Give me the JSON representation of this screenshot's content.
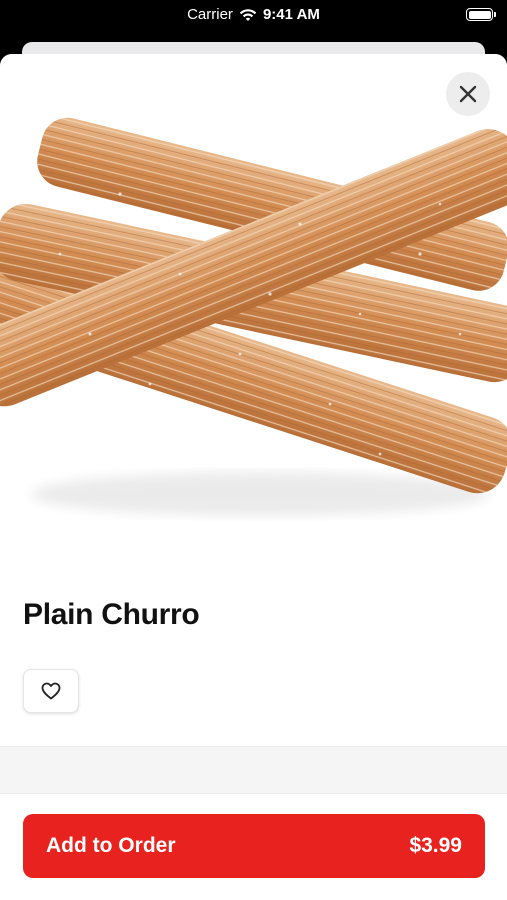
{
  "status_bar": {
    "carrier": "Carrier",
    "time": "9:41 AM"
  },
  "product": {
    "name": "Plain Churro",
    "image_icon": "churro-photo"
  },
  "actions": {
    "close_icon": "close-icon",
    "favorite_icon": "heart-icon",
    "add_to_order_label": "Add to Order",
    "price": "$3.99"
  },
  "colors": {
    "accent": "#e8231f",
    "churro": "#d9945a"
  }
}
